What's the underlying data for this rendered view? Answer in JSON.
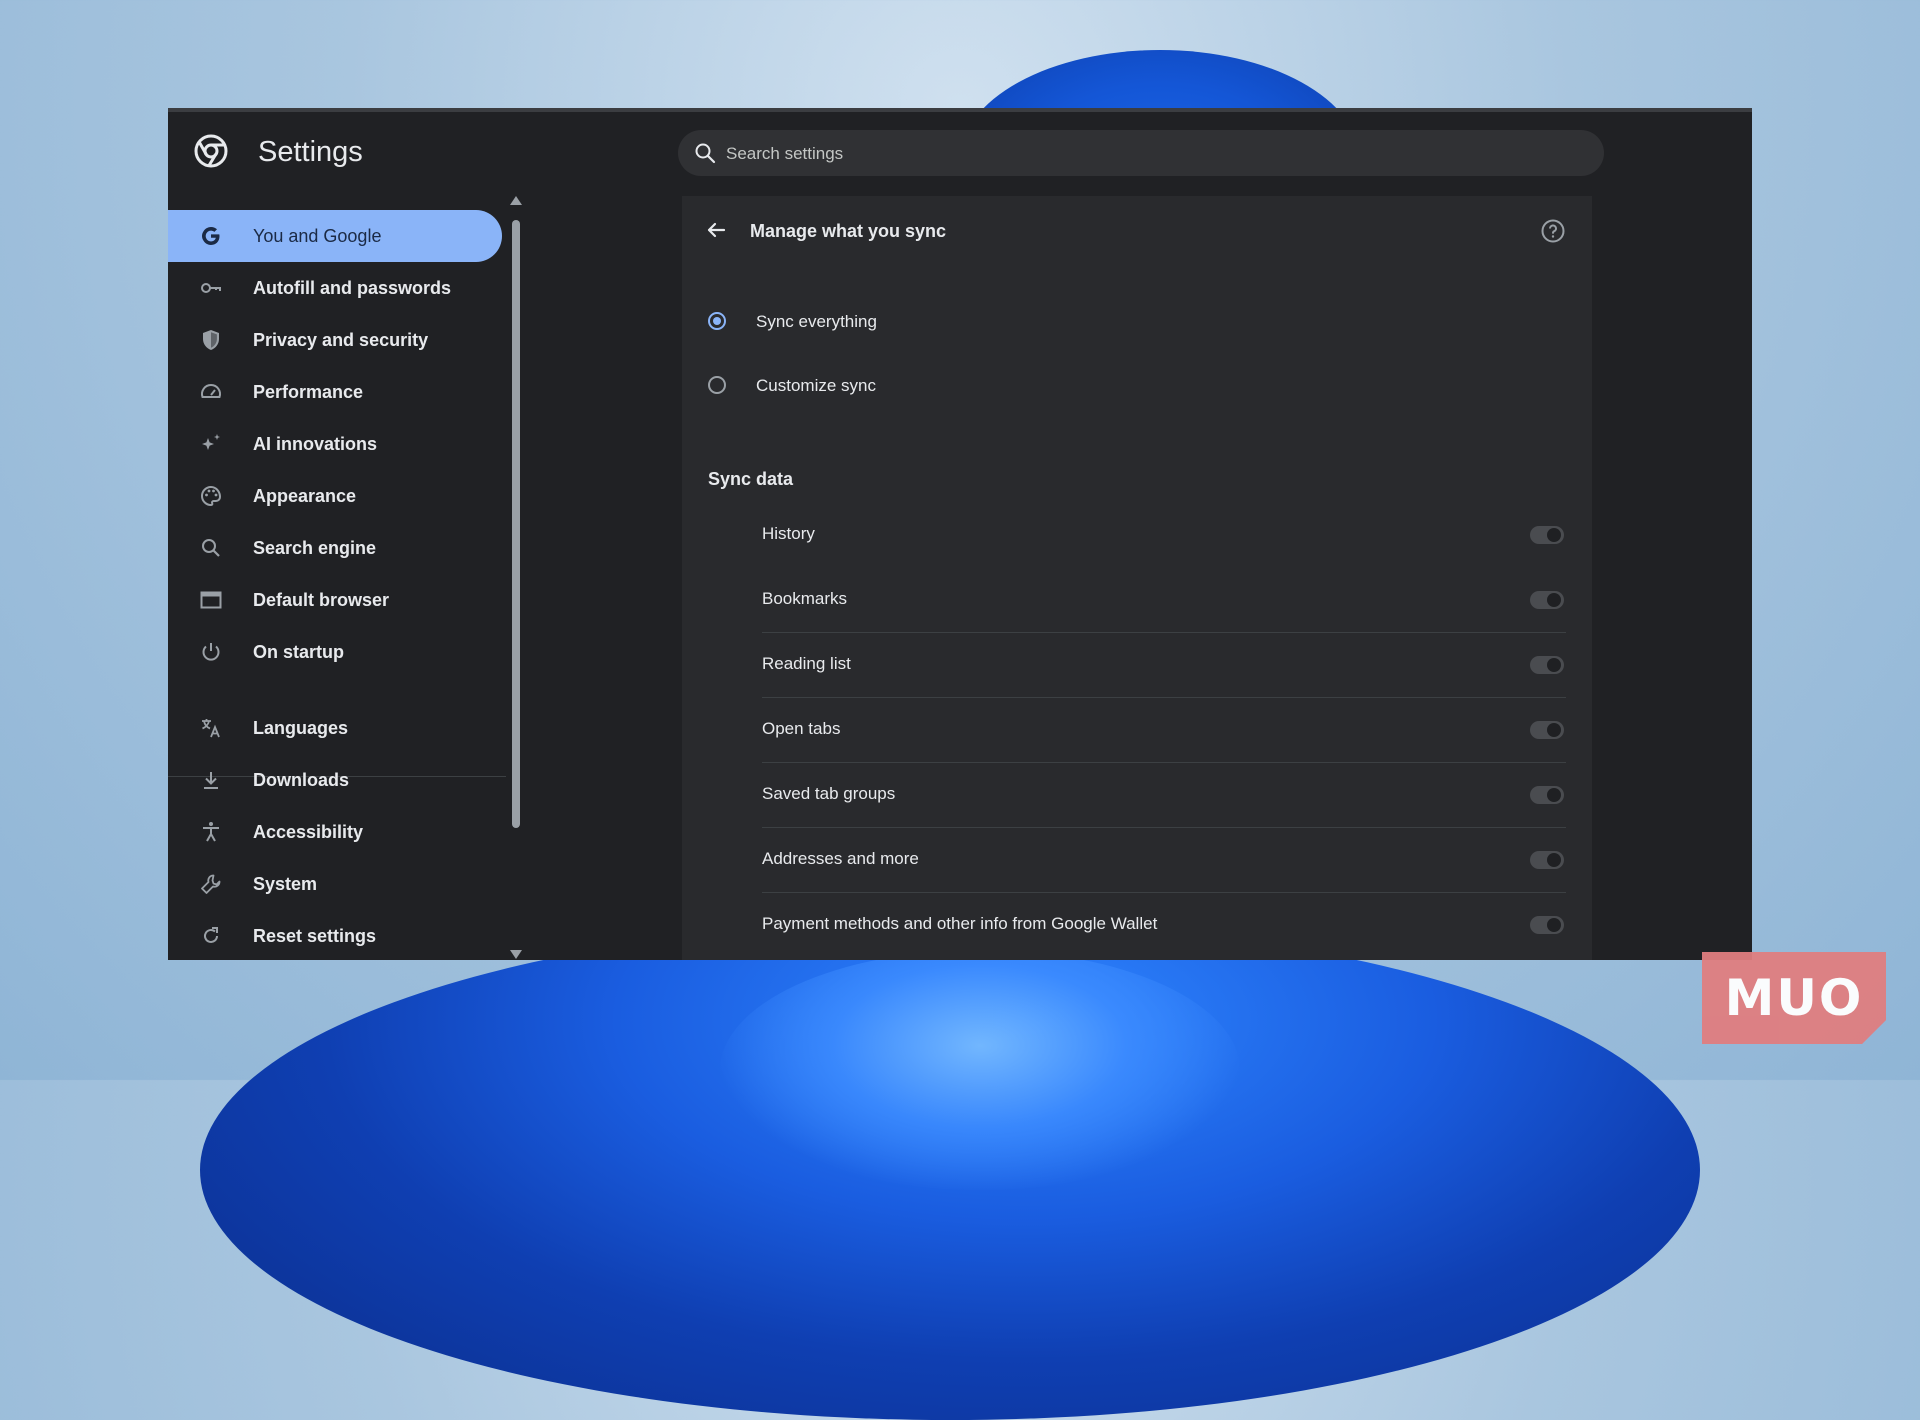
{
  "app": {
    "title": "Settings"
  },
  "search": {
    "placeholder": "Search settings"
  },
  "sidebar": {
    "items": [
      {
        "label": "You and Google",
        "icon": "google-g-icon",
        "active": true
      },
      {
        "label": "Autofill and passwords",
        "icon": "key-icon"
      },
      {
        "label": "Privacy and security",
        "icon": "shield-icon"
      },
      {
        "label": "Performance",
        "icon": "speedometer-icon"
      },
      {
        "label": "AI innovations",
        "icon": "sparkle-icon"
      },
      {
        "label": "Appearance",
        "icon": "palette-icon"
      },
      {
        "label": "Search engine",
        "icon": "search-icon"
      },
      {
        "label": "Default browser",
        "icon": "browser-window-icon"
      },
      {
        "label": "On startup",
        "icon": "power-icon"
      },
      {
        "label": "Languages",
        "icon": "translate-icon"
      },
      {
        "label": "Downloads",
        "icon": "download-icon"
      },
      {
        "label": "Accessibility",
        "icon": "accessibility-icon"
      },
      {
        "label": "System",
        "icon": "wrench-icon"
      },
      {
        "label": "Reset settings",
        "icon": "reset-icon"
      }
    ]
  },
  "main": {
    "title": "Manage what you sync",
    "options": [
      {
        "label": "Sync everything",
        "checked": true
      },
      {
        "label": "Customize sync",
        "checked": false
      }
    ],
    "section_title": "Sync data",
    "sync_items": [
      {
        "label": "History",
        "on": false
      },
      {
        "label": "Bookmarks",
        "on": false
      },
      {
        "label": "Reading list",
        "on": false
      },
      {
        "label": "Open tabs",
        "on": false
      },
      {
        "label": "Saved tab groups",
        "on": false
      },
      {
        "label": "Addresses and more",
        "on": false
      },
      {
        "label": "Payment methods and other info from Google Wallet",
        "on": false
      }
    ]
  },
  "watermark": {
    "text": "MUO"
  },
  "colors": {
    "accent": "#8ab4f8",
    "window_bg": "#202124",
    "card_bg": "#292a2d",
    "text": "#e8eaed"
  }
}
